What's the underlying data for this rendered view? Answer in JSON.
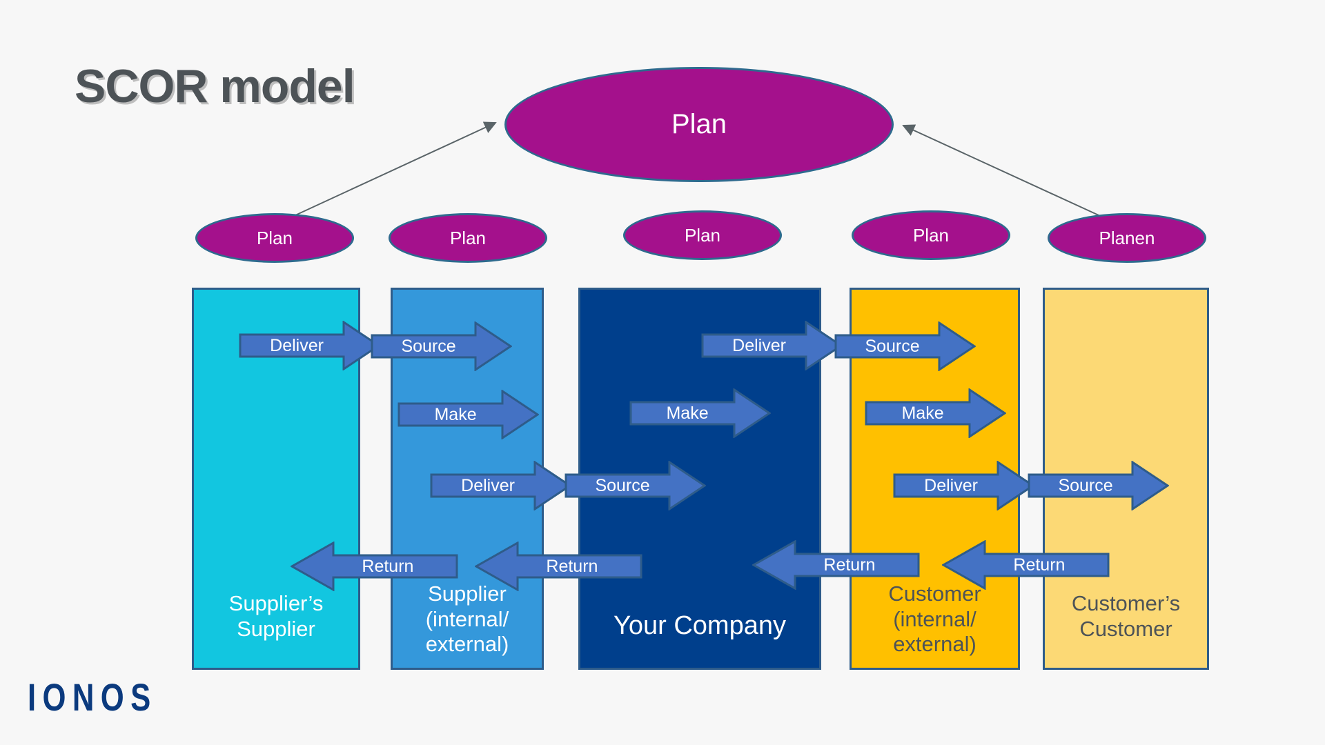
{
  "title": "SCOR model",
  "brand": {
    "logo_text": "IONOS",
    "logo_color": "#0B3A7E"
  },
  "colors": {
    "background": "#f7f7f7",
    "ellipse_fill": "#A4118C",
    "ellipse_border": "#2E6A8E",
    "arrow_fill": "#4472C4",
    "arrow_border": "#2E5C8A",
    "column_border": "#2E5C8A",
    "title_color": "#4d5357",
    "col_1": "#12C6E0",
    "col_2": "#3498DB",
    "col_3": "#003F8C",
    "col_4": "#FFC000",
    "col_5": "#FCD975"
  },
  "plan_main": {
    "label": "Plan"
  },
  "plan_row": [
    {
      "label": "Plan"
    },
    {
      "label": "Plan"
    },
    {
      "label": "Plan"
    },
    {
      "label": "Plan"
    },
    {
      "label": "Planen"
    }
  ],
  "columns": [
    {
      "label": "Supplier’s\nSupplier"
    },
    {
      "label": "Supplier\n(internal/\nexternal)"
    },
    {
      "label": "Your Company"
    },
    {
      "label": "Customer\n(internal/\nexternal)"
    },
    {
      "label": "Customer’s\nCustomer"
    }
  ],
  "arrows": {
    "row_top": [
      {
        "label": "Deliver",
        "direction": "right"
      },
      {
        "label": "Source",
        "direction": "right"
      },
      {
        "label": "Deliver",
        "direction": "right"
      },
      {
        "label": "Source",
        "direction": "right"
      }
    ],
    "row_make": [
      {
        "label": "Make",
        "direction": "right"
      },
      {
        "label": "Make",
        "direction": "right"
      },
      {
        "label": "Make",
        "direction": "right"
      }
    ],
    "row_mid": [
      {
        "label": "Deliver",
        "direction": "right"
      },
      {
        "label": "Source",
        "direction": "right"
      },
      {
        "label": "Deliver",
        "direction": "right"
      },
      {
        "label": "Source",
        "direction": "right"
      }
    ],
    "row_return": [
      {
        "label": "Return",
        "direction": "left"
      },
      {
        "label": "Return",
        "direction": "left"
      },
      {
        "label": "Return",
        "direction": "left"
      },
      {
        "label": "Return",
        "direction": "left"
      }
    ]
  }
}
